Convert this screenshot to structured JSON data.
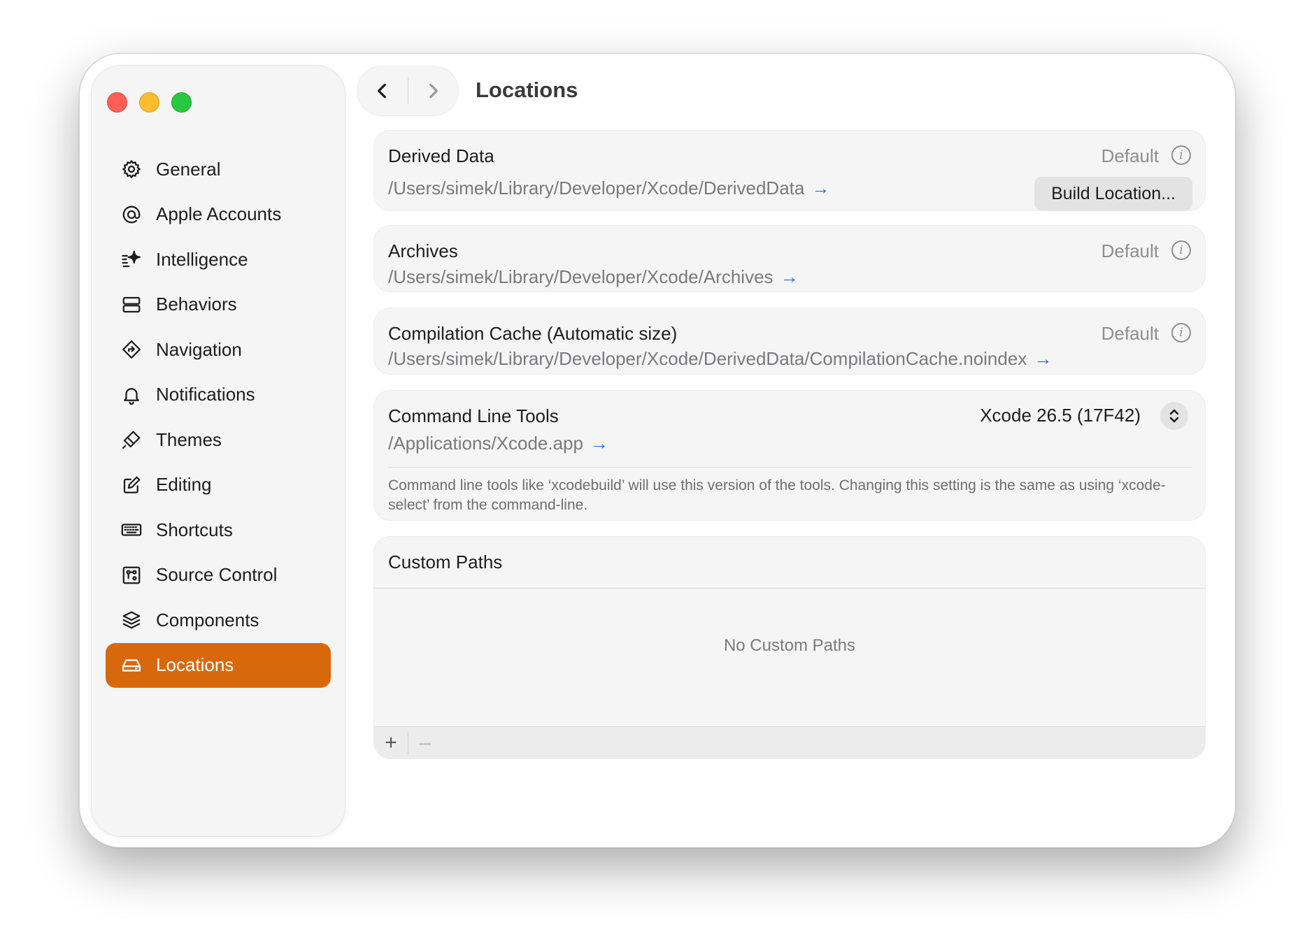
{
  "window": {
    "title": "Locations"
  },
  "sidebar": {
    "items": [
      {
        "label": "General",
        "icon": "gear-icon"
      },
      {
        "label": "Apple Accounts",
        "icon": "at-icon"
      },
      {
        "label": "Intelligence",
        "icon": "sparkle-icon"
      },
      {
        "label": "Behaviors",
        "icon": "behaviors-icon"
      },
      {
        "label": "Navigation",
        "icon": "navigation-diamond-icon"
      },
      {
        "label": "Notifications",
        "icon": "bell-icon"
      },
      {
        "label": "Themes",
        "icon": "brush-icon"
      },
      {
        "label": "Editing",
        "icon": "edit-square-icon"
      },
      {
        "label": "Shortcuts",
        "icon": "keyboard-icon"
      },
      {
        "label": "Source Control",
        "icon": "source-control-icon"
      },
      {
        "label": "Components",
        "icon": "layers-icon"
      },
      {
        "label": "Locations",
        "icon": "drive-icon",
        "selected": true
      }
    ]
  },
  "toolbar": {
    "back_icon": "chevron-left-icon",
    "forward_icon": "chevron-right-icon"
  },
  "derived_data": {
    "title": "Derived Data",
    "status": "Default",
    "path": "/Users/simek/Library/Developer/Xcode/DerivedData",
    "button": "Build Location..."
  },
  "archives": {
    "title": "Archives",
    "status": "Default",
    "path": "/Users/simek/Library/Developer/Xcode/Archives"
  },
  "compilation_cache": {
    "title": "Compilation Cache (Automatic size)",
    "status": "Default",
    "path": "/Users/simek/Library/Developer/Xcode/DerivedData/CompilationCache.noindex"
  },
  "command_line_tools": {
    "title": "Command Line Tools",
    "selected": "Xcode 26.5 (17F42)",
    "path": "/Applications/Xcode.app",
    "description": "Command line tools like ‘xcodebuild’ will use this version of the tools. Changing this setting is the same as using ‘xcode-select’ from the command-line."
  },
  "custom_paths": {
    "title": "Custom Paths",
    "empty_text": "No Custom Paths",
    "add": "+",
    "remove": "–"
  },
  "arrow_glyph": "→",
  "info_glyph": "i",
  "colors": {
    "accent": "#d9680c",
    "link": "#1a6fe0"
  }
}
